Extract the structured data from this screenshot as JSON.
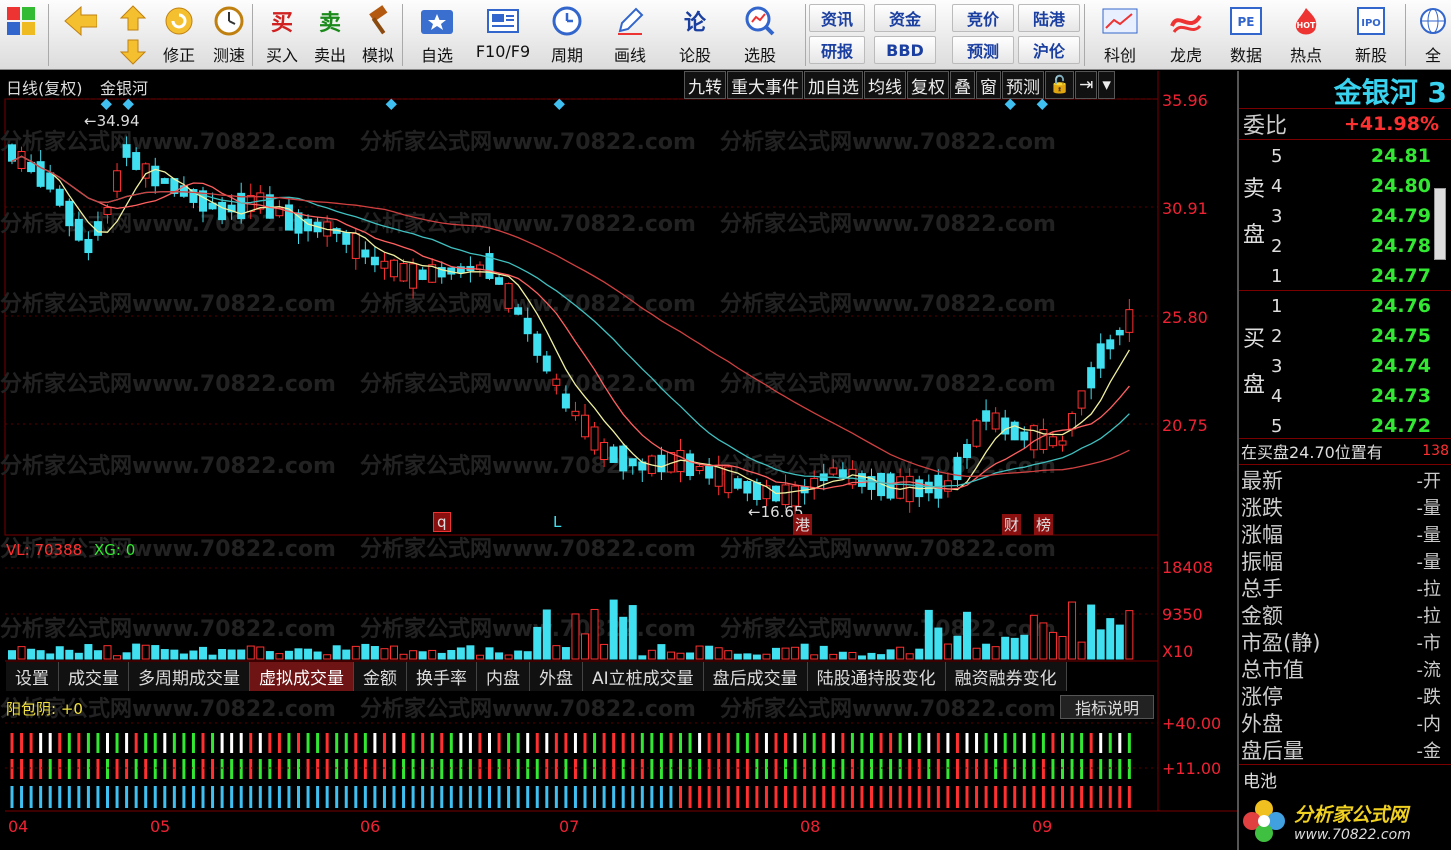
{
  "toolbar": {
    "buttons": [
      {
        "label": "",
        "icon": "windows-logo-icon"
      },
      {
        "label": "",
        "icon": "back-arrow-icon"
      },
      {
        "label": "修正",
        "icon": "revise-icon"
      },
      {
        "label": "测速",
        "icon": "speed-test-icon"
      },
      {
        "label": "买入",
        "icon": "buy-icon",
        "glyph": "买"
      },
      {
        "label": "卖出",
        "icon": "sell-icon",
        "glyph": "卖"
      },
      {
        "label": "模拟",
        "icon": "hammer-icon"
      },
      {
        "label": "自选",
        "icon": "star-icon"
      },
      {
        "label": "F10/F9",
        "icon": "f10-icon"
      },
      {
        "label": "周期",
        "icon": "clock-icon"
      },
      {
        "label": "画线",
        "icon": "pencil-icon"
      },
      {
        "label": "论股",
        "icon": "discuss-icon",
        "glyph": "论"
      },
      {
        "label": "选股",
        "icon": "stock-picker-icon"
      },
      {
        "label": "科创",
        "icon": "sci-tech-icon"
      },
      {
        "label": "龙虎",
        "icon": "dragon-tiger-icon"
      },
      {
        "label": "数据",
        "icon": "pe-data-icon"
      },
      {
        "label": "热点",
        "icon": "hot-icon"
      },
      {
        "label": "新股",
        "icon": "ipo-icon"
      },
      {
        "label": "全",
        "icon": "globe-icon"
      }
    ],
    "mini_buttons": [
      "资讯",
      "资金",
      "竞价",
      "陆港",
      "研报",
      "BBD",
      "预测",
      "沪伦"
    ]
  },
  "chart": {
    "title": "日线(复权)",
    "stock": "金银河",
    "tabs": [
      "九转",
      "重大事件",
      "加自选",
      "均线",
      "复权",
      "叠",
      "窗",
      "预测",
      "🔓",
      "⇥",
      "▾"
    ],
    "price_axis": [
      "35.96",
      "30.91",
      "25.80",
      "20.75"
    ],
    "vol_axis": [
      "18408",
      "9350",
      "X10"
    ],
    "ind_axis": [
      "+40.00",
      "+11.00"
    ],
    "high_label": "34.94",
    "low_label": "16.65",
    "event_tags": [
      "q",
      "L",
      "港",
      "财",
      "榜"
    ],
    "vol_info": {
      "label": "VL: 70388",
      "xg": "XG: 0"
    },
    "ind_info": "阳包阴: +0",
    "months": [
      "04",
      "05",
      "06",
      "07",
      "08",
      "09"
    ],
    "indicator_tabs": [
      "设置",
      "成交量",
      "多周期成交量",
      "虚拟成交量",
      "金额",
      "换手率",
      "内盘",
      "外盘",
      "AI立桩成交量",
      "盘后成交量",
      "陆股通持股变化",
      "融资融券变化"
    ],
    "help_button": "指标说明",
    "watermark": "分析家公式网www.70822.com"
  },
  "panel": {
    "stock_name": "金银河 3",
    "weibi_label": "委比",
    "weibi_value": "+41.98%",
    "sell_label": [
      "卖",
      "盘"
    ],
    "buy_label": [
      "买",
      "盘"
    ],
    "sell": [
      {
        "lv": "5",
        "price": "24.81"
      },
      {
        "lv": "4",
        "price": "24.80"
      },
      {
        "lv": "3",
        "price": "24.79"
      },
      {
        "lv": "2",
        "price": "24.78"
      },
      {
        "lv": "1",
        "price": "24.77"
      }
    ],
    "buy": [
      {
        "lv": "1",
        "price": "24.76"
      },
      {
        "lv": "2",
        "price": "24.75"
      },
      {
        "lv": "3",
        "price": "24.74"
      },
      {
        "lv": "4",
        "price": "24.73"
      },
      {
        "lv": "5",
        "price": "24.72"
      }
    ],
    "notice": "在买盘24.70位置有",
    "notice_val": "138",
    "quote": [
      {
        "k": "最新",
        "v": "-开"
      },
      {
        "k": "涨跌",
        "v": "-量"
      },
      {
        "k": "涨幅",
        "v": "-量"
      },
      {
        "k": "振幅",
        "v": "-量"
      },
      {
        "k": "总手",
        "v": "-拉"
      },
      {
        "k": "金额",
        "v": "-拉"
      },
      {
        "k": "市盈(静)",
        "v": "-市"
      },
      {
        "k": "总市值",
        "v": "-流"
      },
      {
        "k": "涨停",
        "v": "-跌"
      },
      {
        "k": "外盘",
        "v": "-内"
      },
      {
        "k": "盘后量",
        "v": "-金"
      }
    ],
    "battery": "电池",
    "logo_text": "分析家公式网",
    "logo_url": "www.70822.com"
  },
  "colors": {
    "up": "#ff3030",
    "down": "#40e0f0",
    "ma5": "#f0f0a0",
    "ma10": "#ff6060",
    "ma20": "#40c0c0",
    "ma60": "#d04040"
  }
}
